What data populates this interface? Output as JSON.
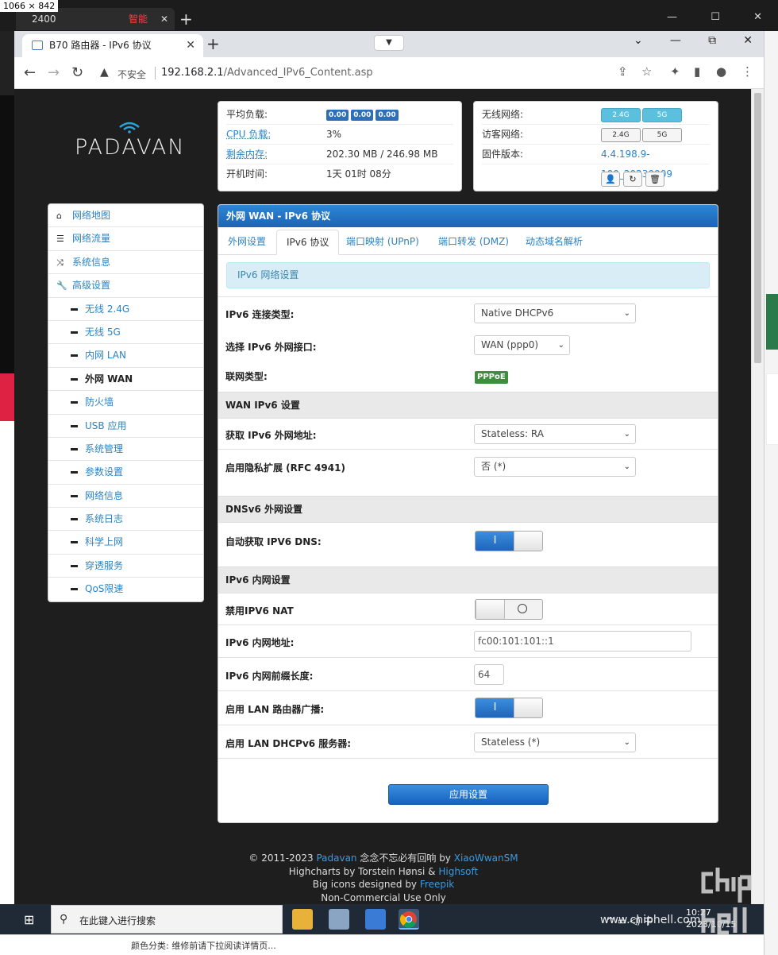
{
  "screen_size_label": "1066 × 842",
  "back_tab": {
    "label": "2400",
    "alert": "智能",
    "close": "✕"
  },
  "browser": {
    "tab_title": "B70 路由器 - IPv6 协议",
    "tab_close": "✕",
    "new_tab": "+",
    "security_label": "不安全",
    "url_host": "192.168.2.1",
    "url_path": "/Advanced_IPv6_Content.asp"
  },
  "logo_text": "PADAVAN",
  "sys_status": {
    "load_label": "平均负载:",
    "load_values": [
      "0.00",
      "0.00",
      "0.00"
    ],
    "cpu_label": "CPU 负载:",
    "cpu_value": "3%",
    "mem_label": "剩余内存:",
    "mem_value": "202.30 MB / 246.98 MB",
    "uptime_label": "开机时间:",
    "uptime_value": "1天 01时 08分"
  },
  "net_status": {
    "wifi_label": "无线网络:",
    "guest_label": "访客网络:",
    "fw_label": "固件版本:",
    "band_24": "2.4G",
    "band_5": "5G",
    "fw_value": "4.4.198.9-100_20230909"
  },
  "menu": {
    "top": [
      {
        "label": "网络地图",
        "icon": "home-icon"
      },
      {
        "label": "网络流量",
        "icon": "list-icon"
      },
      {
        "label": "系统信息",
        "icon": "shuffle-icon"
      },
      {
        "label": "高级设置",
        "icon": "wrench-icon"
      }
    ],
    "sub": [
      "无线 2.4G",
      "无线 5G",
      "内网 LAN",
      "外网 WAN",
      "防火墙",
      "USB 应用",
      "系统管理",
      "参数设置",
      "网络信息",
      "系统日志",
      "科学上网",
      "穿透服务",
      "QoS限速"
    ],
    "active": "外网 WAN"
  },
  "panel": {
    "title": "外网 WAN - IPv6 协议",
    "tabs": [
      "外网设置",
      "IPv6 协议",
      "端口映射 (UPnP)",
      "端口转发 (DMZ)",
      "动态域名解析"
    ],
    "info": "IPv6 网络设置",
    "fields": {
      "conn_type_label": "IPv6 连接类型:",
      "conn_type_value": "Native DHCPv6",
      "wan_if_label": "选择 IPv6 外网接口:",
      "wan_if_value": "WAN (ppp0)",
      "link_type_label": "联网类型:",
      "link_type_value": "PPPoE"
    },
    "sections": {
      "wan": "WAN IPv6 设置",
      "dns": "DNSv6 外网设置",
      "lan": "IPv6 内网设置"
    },
    "wan_fields": {
      "addr_label": "获取 IPv6 外网地址:",
      "addr_value": "Stateless: RA",
      "privacy_label": "启用隐私扩展 (RFC 4941)",
      "privacy_value": "否 (*)"
    },
    "dns_fields": {
      "auto_dns_label": "自动获取 IPV6 DNS:",
      "auto_dns_on": true
    },
    "lan_fields": {
      "nat_label": "禁用IPV6 NAT",
      "nat_on": false,
      "addr_label": "IPv6 内网地址:",
      "addr_value": "fc00:101:101::1",
      "prefix_label": "IPv6 内网前缀长度:",
      "prefix_value": "64",
      "ra_label": "启用 LAN 路由器广播:",
      "ra_on": true,
      "dhcp_label": "启用 LAN DHCPv6 服务器:",
      "dhcp_value": "Stateless (*)"
    },
    "toggle_on_glyph": "I",
    "apply_label": "应用设置"
  },
  "footer": {
    "line1_prefix": "© 2011-2023",
    "line1_link1": "Padavan",
    "line1_mid": "念念不忘必有回响 by",
    "line1_link2": "XiaoWwanSM",
    "line2_prefix": "Highcharts by Torstein Hønsi &",
    "line2_link": "Highsoft",
    "line3_prefix": "Big icons designed by",
    "line3_link": "Freepik",
    "line4": "Non-Commercial Use Only"
  },
  "taskbar": {
    "search_placeholder": "在此键入进行搜索",
    "tray_lang": "中",
    "clock_time": "10:27",
    "clock_date": "2023/10/15"
  },
  "watermark": "www.chiphell.com",
  "bottom_strip_text": "颜色分类: 维修前请下拉阅读详情页..."
}
